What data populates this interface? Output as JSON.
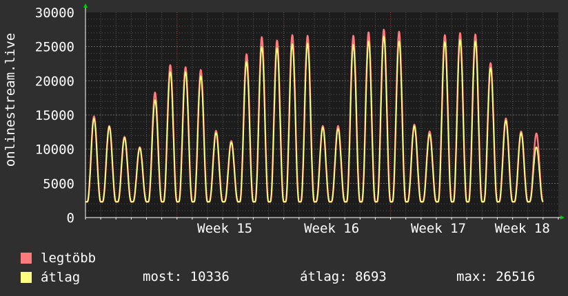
{
  "chart_data": {
    "type": "line",
    "ylabel": "onlinestream.live",
    "ylim": [
      0,
      30000
    ],
    "yticks": [
      0,
      5000,
      10000,
      15000,
      20000,
      25000,
      30000
    ],
    "yticklabels": [
      "0",
      "5000",
      "10000",
      "15000",
      "20000",
      "25000",
      "30000"
    ],
    "xtick_labels": [
      "Week 15",
      "Week 16",
      "Week 17",
      "Week 18"
    ],
    "week_start_day": [
      6,
      13,
      20,
      27
    ],
    "x_unit": "day",
    "x_range_days": [
      0,
      31
    ],
    "grid": true,
    "series": [
      {
        "name": "legtöbb",
        "color": "#ff7a7a",
        "daily_peak": [
          14800,
          13400,
          11800,
          10300,
          18300,
          22300,
          22000,
          21600,
          12700,
          11200,
          23900,
          26400,
          25900,
          26700,
          26600,
          13400,
          13400,
          26600,
          27100,
          27500,
          27200,
          13600,
          12600,
          26700,
          27000,
          26800,
          22600,
          14500,
          12600,
          12300
        ]
      },
      {
        "name": "átlag",
        "color": "#ffff80",
        "daily_peak": [
          14500,
          13300,
          11700,
          10200,
          17200,
          21300,
          21300,
          20700,
          12400,
          11000,
          22800,
          25000,
          24800,
          25400,
          25500,
          13200,
          13000,
          25300,
          25800,
          26500,
          25800,
          13400,
          12200,
          25700,
          26000,
          25800,
          21900,
          14200,
          12400,
          10300
        ]
      }
    ]
  },
  "legend": {
    "max_label": "legtöbb",
    "avg_label": "átlag"
  },
  "stats": {
    "current_label": "most:",
    "current_value": "10336",
    "avg_label": "átlag:",
    "avg_value": "8693",
    "max_label": "max:",
    "max_value": "26516"
  },
  "colors": {
    "background": "#2f2f2f",
    "plot_background": "#1c1c1c",
    "grid": "#555555",
    "axis_arrow": "#00cc00",
    "text": "#ffffff"
  }
}
